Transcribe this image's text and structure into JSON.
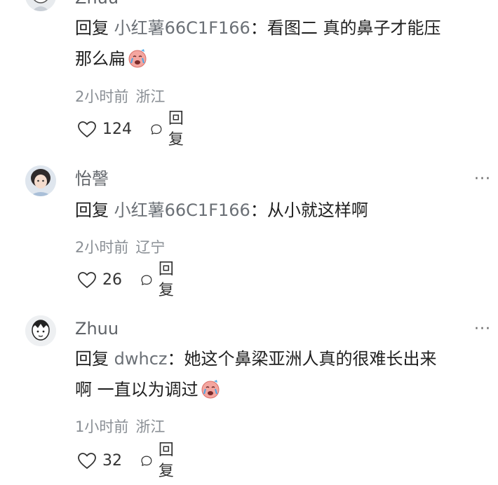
{
  "comments": [
    {
      "username": "Zhuu",
      "reply_prefix": "回复",
      "reply_target": "小红薯66C1F166",
      "separator": "：",
      "text_line1": "看图二 真的鼻子才能压",
      "text_line2": "那么扁",
      "time": "2小时前",
      "region": "浙江",
      "likes": "124",
      "reply_label": "回复",
      "emoji": "crying-face"
    },
    {
      "username": "怡謦",
      "reply_prefix": "回复",
      "reply_target": "小红薯66C1F166",
      "separator": "：",
      "text_line1": "从小就这样啊",
      "time": "2小时前",
      "region": "辽宁",
      "likes": "26",
      "reply_label": "回复",
      "more": "···"
    },
    {
      "username": "Zhuu",
      "reply_prefix": "回复",
      "reply_target": "dwhcz",
      "separator": "：",
      "text_line1": "她这个鼻梁亚洲人真的很难长出来",
      "text_line2": "啊 一直以为调过",
      "time": "1小时前",
      "region": "浙江",
      "likes": "32",
      "reply_label": "回复",
      "more": "···",
      "emoji": "crying-face"
    }
  ],
  "colors": {
    "background": "#ffffff",
    "username": "#5f6368",
    "reply_target": "#6b7076",
    "meta": "#8a8f95"
  }
}
